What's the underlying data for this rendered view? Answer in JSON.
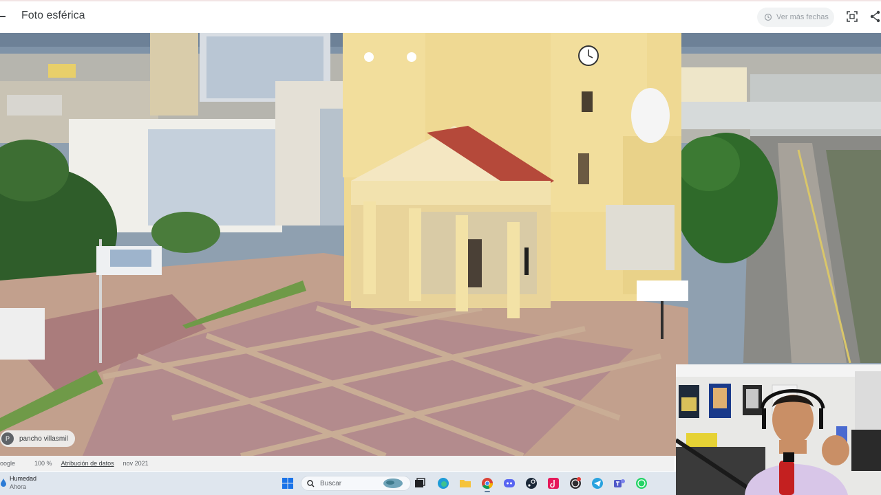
{
  "header": {
    "title": "Foto esférica",
    "more_dates_label": "Ver más fechas",
    "icons": [
      "back-arrow-icon",
      "history-icon",
      "fullscreen-icon",
      "share-icon"
    ]
  },
  "photo": {
    "author_initial": "P",
    "author_name": "pancho villasmil"
  },
  "attribution": {
    "provider": "oogle",
    "zoom": "100 %",
    "data_link": "Atribución de datos",
    "date": "nov 2021"
  },
  "taskbar": {
    "weather_title": "Humedad",
    "weather_sub": "Ahora",
    "search_placeholder": "Buscar",
    "apps": [
      "windows-start-icon",
      "widgets-icon",
      "task-view-icon",
      "edge-icon",
      "file-explorer-icon",
      "chrome-icon",
      "discord-icon",
      "steam-icon",
      "tiktok-icon",
      "obs-icon",
      "telegram-icon",
      "teams-icon",
      "whatsapp-icon"
    ]
  },
  "colors": {
    "accent": "#1a73e8",
    "church_wall": "#efd993",
    "roof": "#b5493a",
    "plaza": "#b8888a"
  }
}
